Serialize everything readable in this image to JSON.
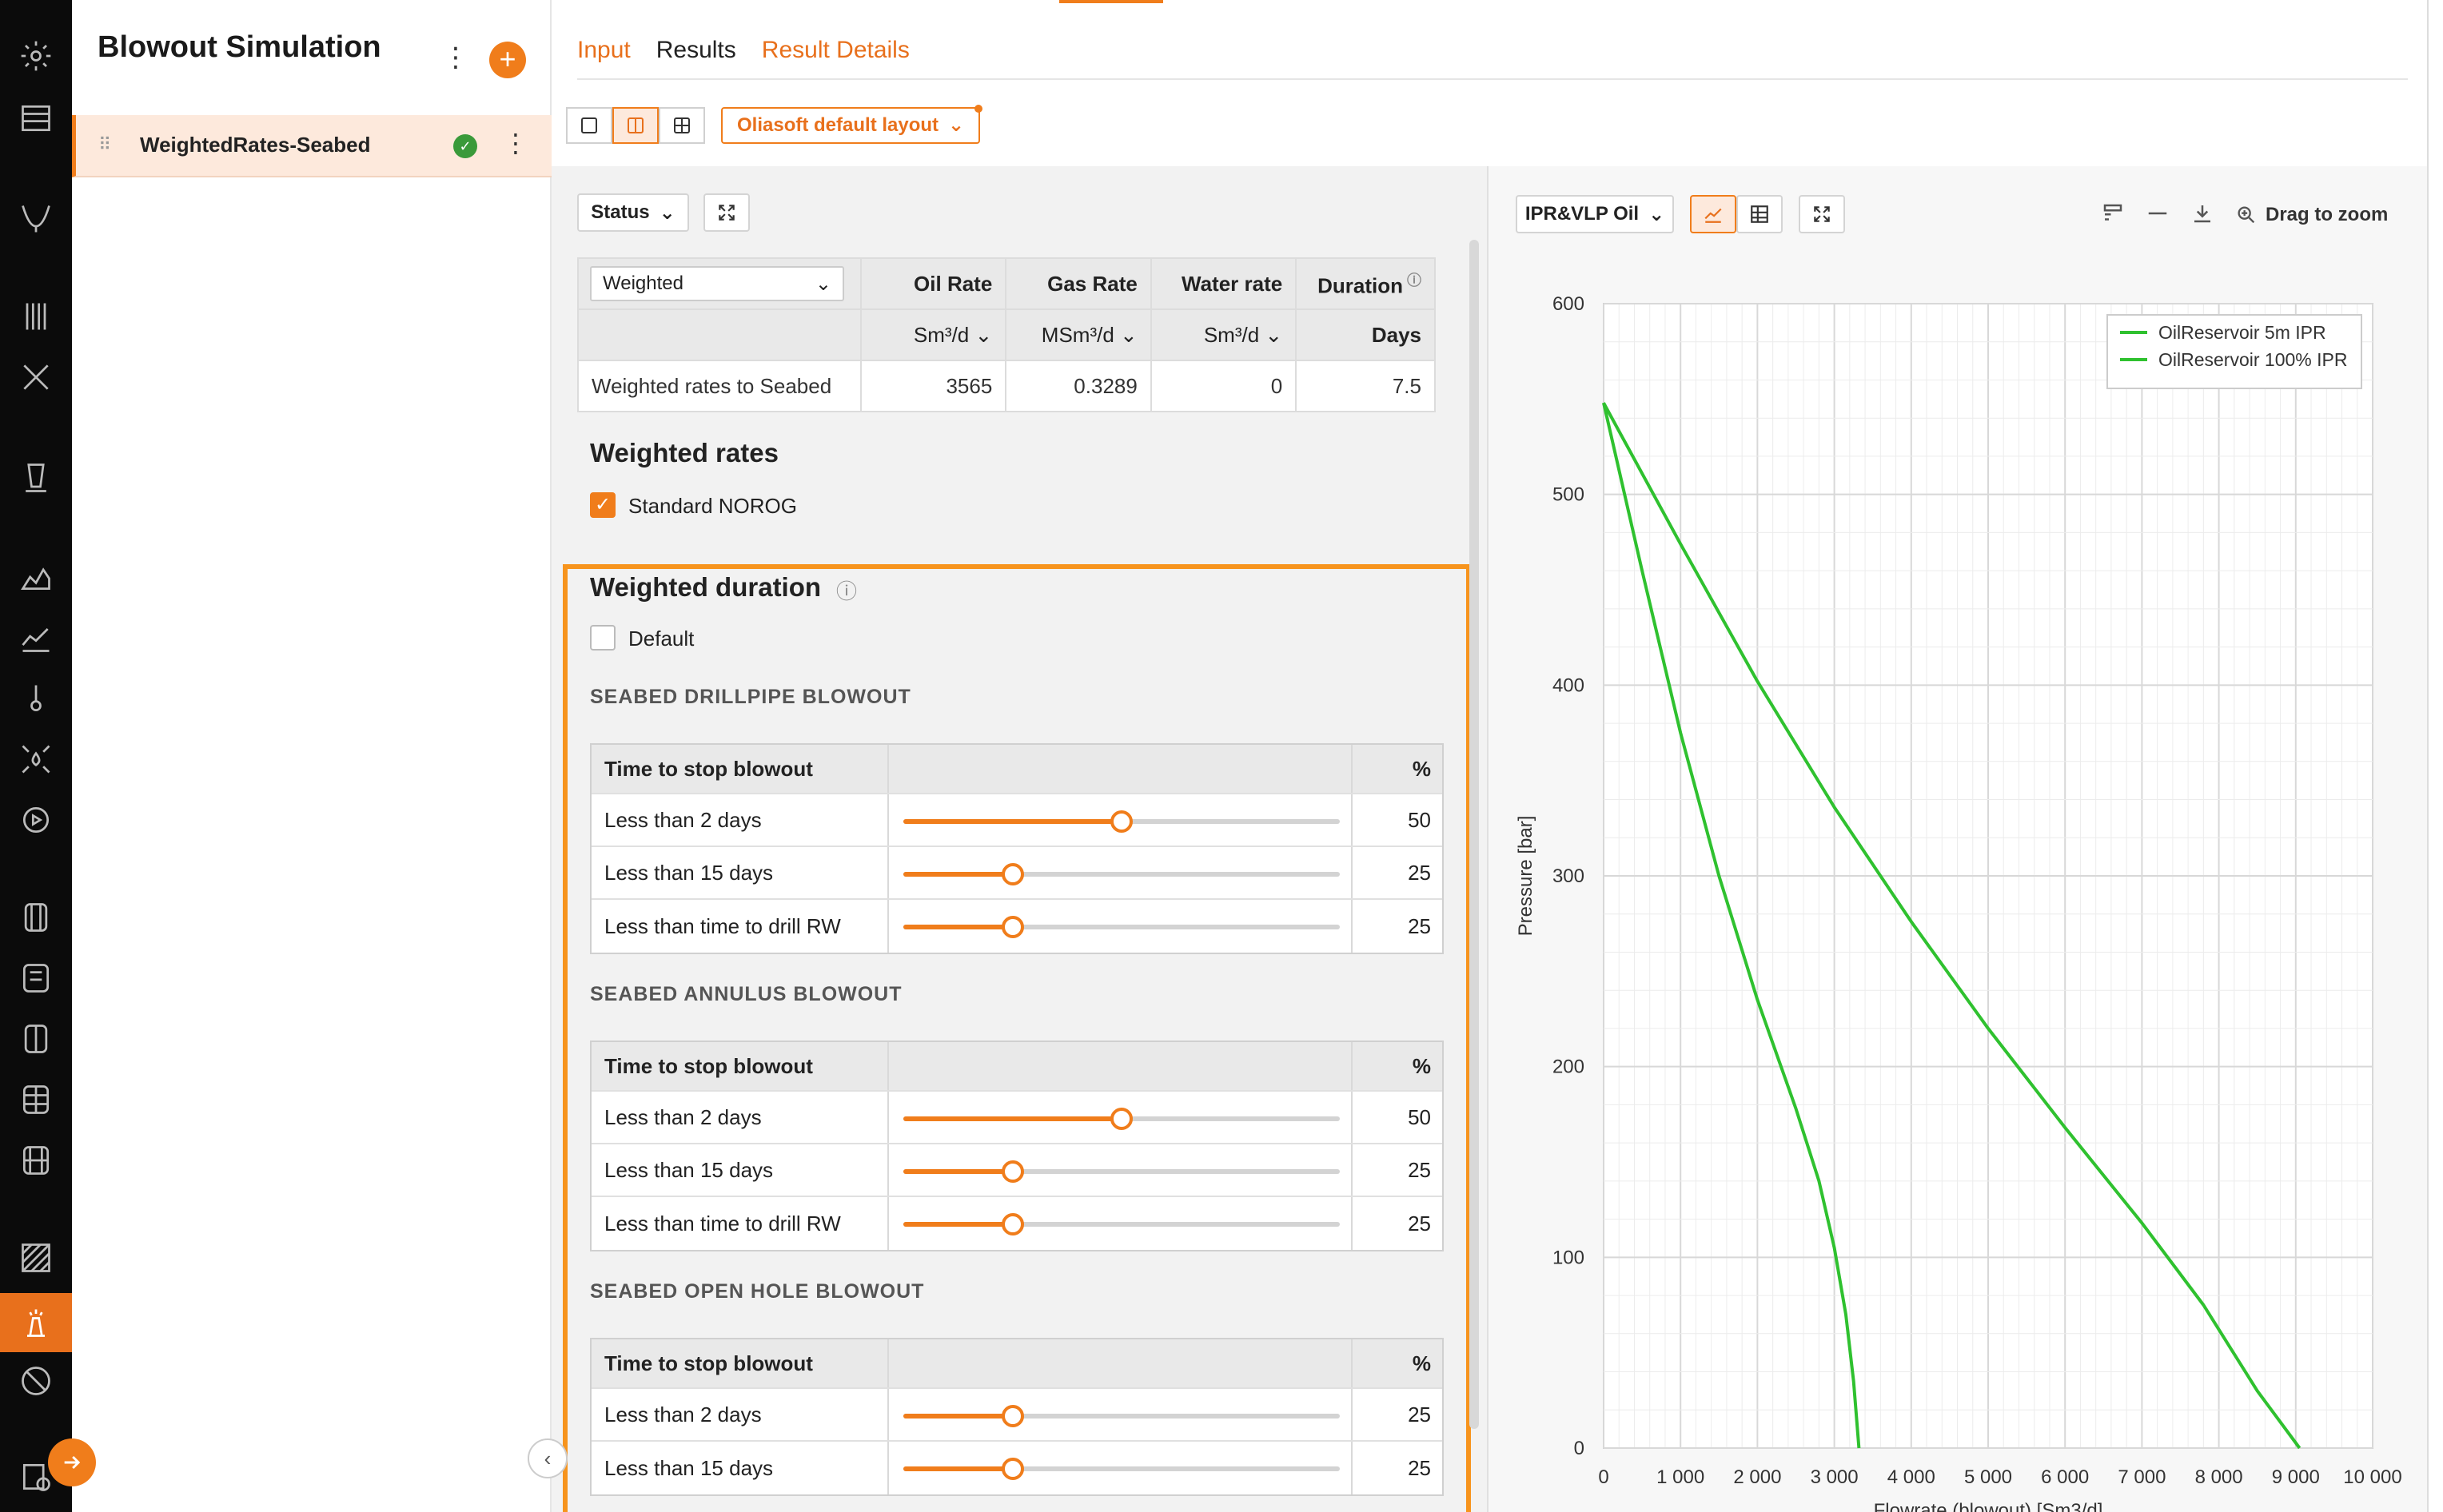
{
  "app": {
    "title": "Blowout Simulation",
    "add_label": "+",
    "item_name": "WeightedRates-Seabed",
    "item_status": "✓"
  },
  "tabs": [
    "Input",
    "Results",
    "Result Details"
  ],
  "active_tab": "Results",
  "layout_select": "Oliasoft default layout",
  "left": {
    "status_label": "Status",
    "rates_table": {
      "selector": "Weighted",
      "headers": [
        "Oil Rate",
        "Gas Rate",
        "Water rate",
        "Duration"
      ],
      "units": [
        "Sm³/d",
        "MSm³/d",
        "Sm³/d",
        "Days"
      ],
      "row_label": "Weighted rates to Seabed",
      "row_values": [
        "3565",
        "0.3289",
        "0",
        "7.5"
      ]
    },
    "weighted_rates_title": "Weighted rates",
    "standard_norog_label": "Standard NOROG",
    "standard_norog_checked": true,
    "weighted_duration_title": "Weighted duration",
    "default_label": "Default",
    "default_checked": false,
    "sections": [
      {
        "title": "SEABED DRILLPIPE BLOWOUT",
        "col1": "Time to stop blowout",
        "col3": "%",
        "rows": [
          {
            "label": "Less than 2 days",
            "value": "50",
            "fraction": 0.5
          },
          {
            "label": "Less than 15 days",
            "value": "25",
            "fraction": 0.25
          },
          {
            "label": "Less than time to drill RW",
            "value": "25",
            "fraction": 0.25
          }
        ]
      },
      {
        "title": "SEABED ANNULUS BLOWOUT",
        "col1": "Time to stop blowout",
        "col3": "%",
        "rows": [
          {
            "label": "Less than 2 days",
            "value": "50",
            "fraction": 0.5
          },
          {
            "label": "Less than 15 days",
            "value": "25",
            "fraction": 0.25
          },
          {
            "label": "Less than time to drill RW",
            "value": "25",
            "fraction": 0.25
          }
        ]
      },
      {
        "title": "SEABED OPEN HOLE BLOWOUT",
        "col1": "Time to stop blowout",
        "col3": "%",
        "rows": [
          {
            "label": "Less than 2 days",
            "value": "25",
            "fraction": 0.25
          },
          {
            "label": "Less than 15 days",
            "value": "25",
            "fraction": 0.25
          }
        ]
      }
    ]
  },
  "right": {
    "chart_select": "IPR&VLP Oil",
    "drag_to_zoom": "Drag to zoom"
  },
  "chart_data": {
    "type": "line",
    "xlabel": "Flowrate (blowout) [Sm3/d]",
    "ylabel": "Pressure [bar]",
    "xlim": [
      0,
      10000
    ],
    "ylim": [
      0,
      600
    ],
    "x_ticks": [
      "0",
      "1 000",
      "2 000",
      "3 000",
      "4 000",
      "5 000",
      "6 000",
      "7 000",
      "8 000",
      "9 000",
      "10 000"
    ],
    "y_ticks": [
      "0",
      "100",
      "200",
      "300",
      "400",
      "500",
      "600"
    ],
    "grid": true,
    "legend_position": "top-right",
    "series": [
      {
        "name": "OilReservoir 5m IPR",
        "color": "#2fc12f",
        "points": [
          [
            0,
            548
          ],
          [
            500,
            460
          ],
          [
            1000,
            375
          ],
          [
            1500,
            300
          ],
          [
            2000,
            235
          ],
          [
            2500,
            178
          ],
          [
            2800,
            140
          ],
          [
            3000,
            105
          ],
          [
            3150,
            70
          ],
          [
            3250,
            35
          ],
          [
            3320,
            0
          ]
        ]
      },
      {
        "name": "OilReservoir 100% IPR",
        "color": "#2fc12f",
        "points": [
          [
            0,
            548
          ],
          [
            1000,
            474
          ],
          [
            2000,
            402
          ],
          [
            3000,
            336
          ],
          [
            4000,
            276
          ],
          [
            5000,
            220
          ],
          [
            6000,
            168
          ],
          [
            7000,
            118
          ],
          [
            7800,
            75
          ],
          [
            8500,
            30
          ],
          [
            9050,
            0
          ]
        ]
      }
    ]
  }
}
